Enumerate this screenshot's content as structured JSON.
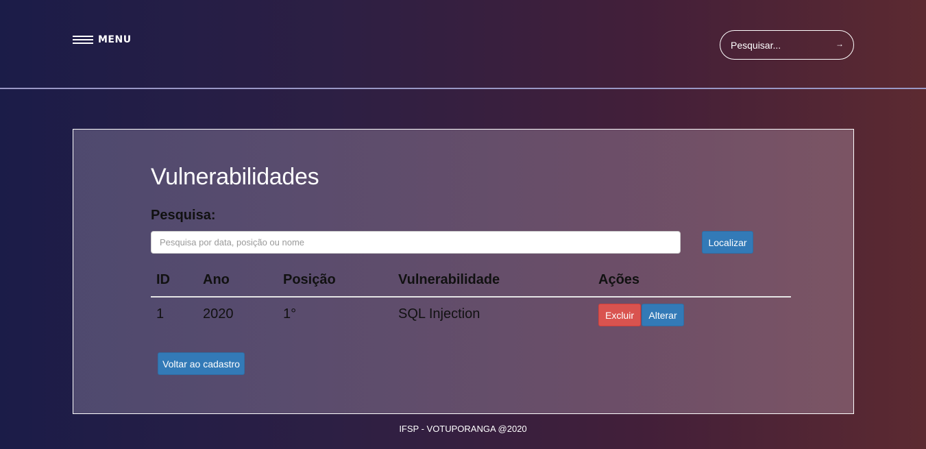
{
  "header": {
    "menu_label": "MENU",
    "search_placeholder": "Pesquisar...",
    "search_submit": "→"
  },
  "main": {
    "title": "Vulnerabilidades",
    "search_label": "Pesquisa:",
    "search_placeholder": "Pesquisa por data, posição ou nome",
    "search_value": "",
    "locate_button": "Localizar",
    "table": {
      "headers": [
        "ID",
        "Ano",
        "Posição",
        "Vulnerabilidade",
        "Ações"
      ],
      "rows": [
        {
          "id": "1",
          "ano": "2020",
          "posicao": "1°",
          "vulnerabilidade": "SQL Injection",
          "delete_label": "Excluir",
          "edit_label": "Alterar"
        }
      ]
    },
    "back_button": "Voltar ao cadastro"
  },
  "footer": {
    "text": "IFSP - VOTUPORANGA @2020"
  },
  "colors": {
    "primary": "#337ab7",
    "danger": "#d9534f",
    "background_left": "#1b1c48",
    "background_right": "#5c2a31"
  },
  "icons": {
    "menu": "hamburger-icon",
    "search_submit": "arrow-right-icon"
  }
}
